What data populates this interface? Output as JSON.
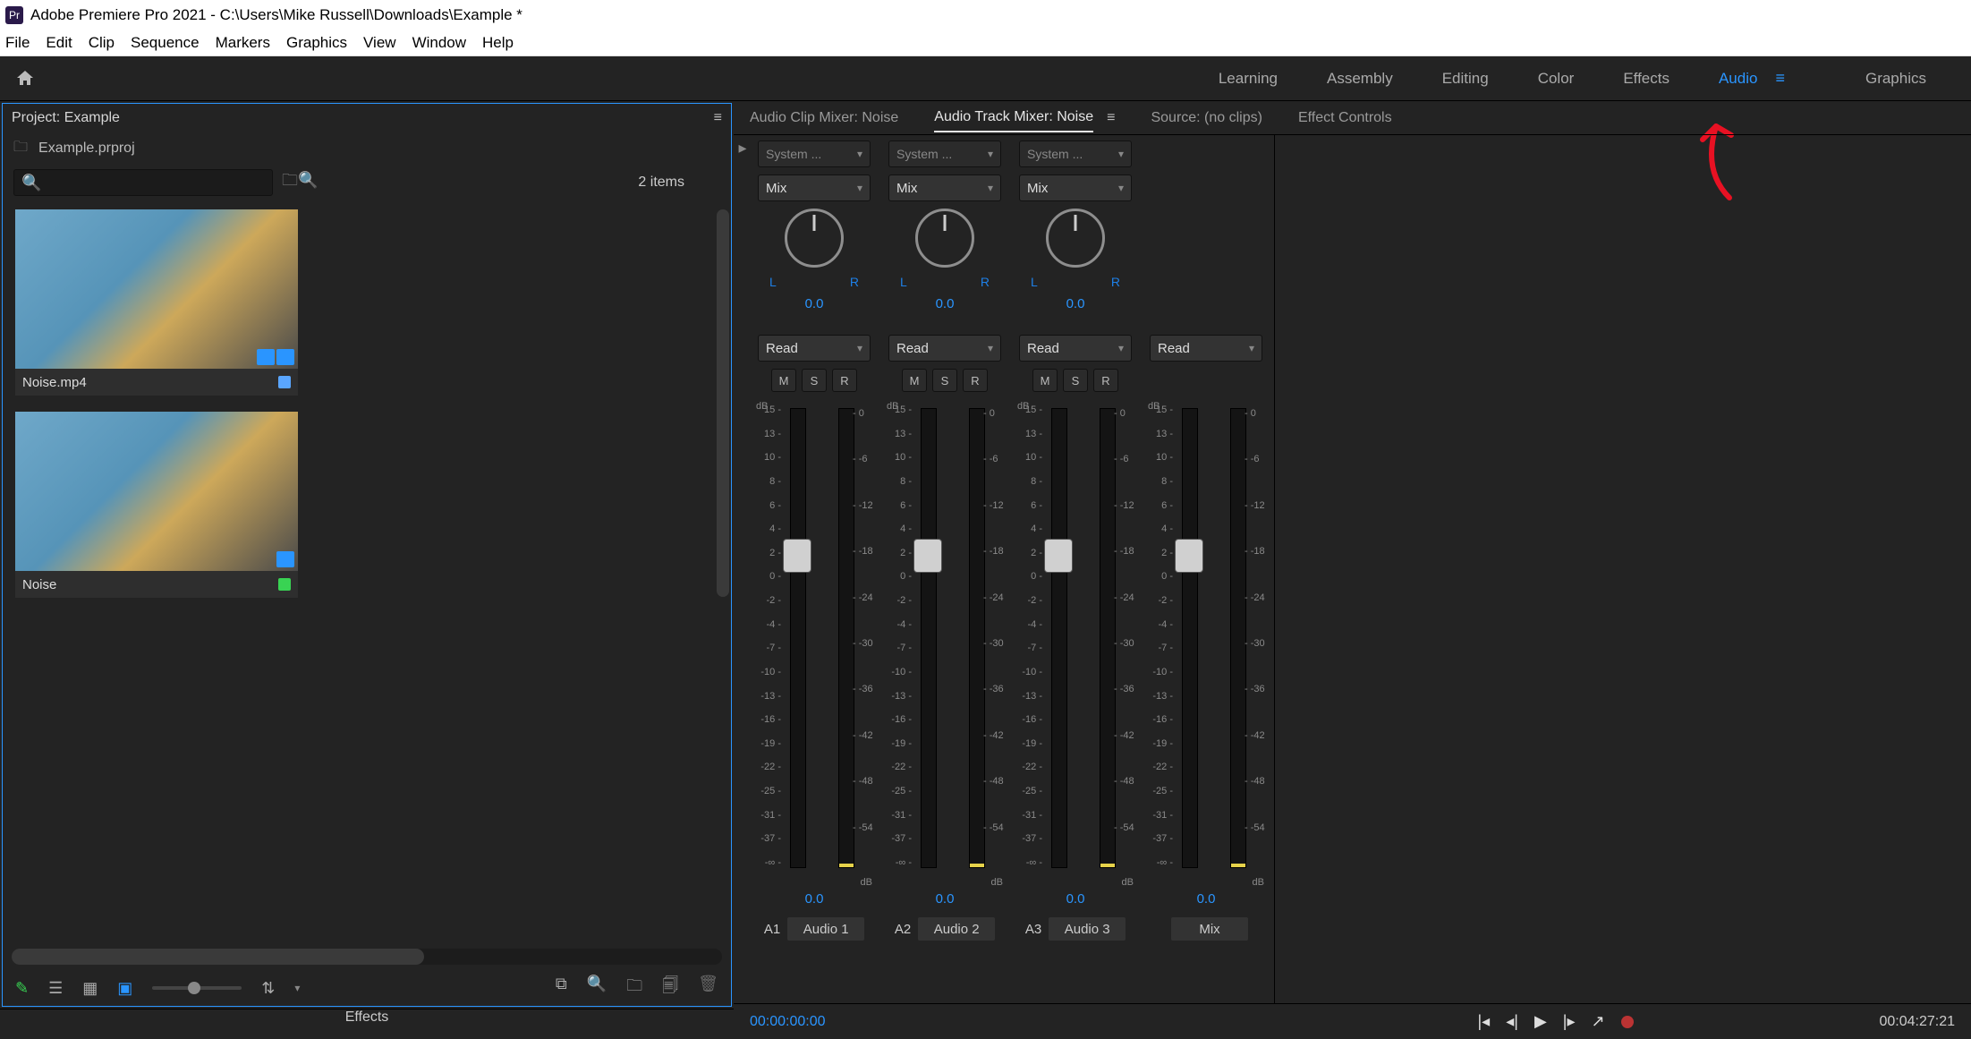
{
  "window": {
    "title": "Adobe Premiere Pro 2021 - C:\\Users\\Mike Russell\\Downloads\\Example *"
  },
  "menu": [
    "File",
    "Edit",
    "Clip",
    "Sequence",
    "Markers",
    "Graphics",
    "View",
    "Window",
    "Help"
  ],
  "workspaces": {
    "items": [
      "Learning",
      "Assembly",
      "Editing",
      "Color",
      "Effects",
      "Audio",
      "Graphics"
    ],
    "active": "Audio"
  },
  "project_panel": {
    "title": "Project: Example",
    "project_file": "Example.prproj",
    "search_placeholder": "",
    "item_count_label": "2 items",
    "items": [
      {
        "name": "Noise.mp4",
        "chip_color": "#5aa6ff",
        "badges": 2
      },
      {
        "name": "Noise",
        "chip_color": "#39d353",
        "badges": 1
      }
    ]
  },
  "effects_panel": {
    "title": "Effects"
  },
  "source_tabs": {
    "items": [
      "Audio Clip Mixer: Noise",
      "Audio Track Mixer: Noise",
      "Source: (no clips)",
      "Effect Controls"
    ],
    "active_index": 1
  },
  "mixer": {
    "system_label": "System ...",
    "mix_label": "Mix",
    "auto_label": "Read",
    "msr": [
      "M",
      "S",
      "R"
    ],
    "pan_value": "0.0",
    "lr": {
      "l": "L",
      "r": "R"
    },
    "db_label_top": "dB",
    "db_label_bottom": "dB",
    "fader_scale": [
      "15 -",
      "13 -",
      "10 -",
      "8 -",
      "6 -",
      "4 -",
      "2 -",
      "0 -",
      "-2 -",
      "-4 -",
      "-7 -",
      "-10 -",
      "-13 -",
      "-16 -",
      "-19 -",
      "-22 -",
      "-25 -",
      "-31 -",
      "-37 -",
      "-∞ -"
    ],
    "meter_scale": [
      "- 0",
      "- -6",
      "- -12",
      "- -18",
      "- -24",
      "- -30",
      "- -36",
      "- -42",
      "- -48",
      "- -54",
      ""
    ],
    "volume_value": "0.0",
    "tracks": [
      {
        "assign_id": "A1",
        "name": "Audio 1"
      },
      {
        "assign_id": "A2",
        "name": "Audio 2"
      },
      {
        "assign_id": "A3",
        "name": "Audio 3"
      }
    ],
    "master": {
      "name": "Mix"
    }
  },
  "transport": {
    "timecode_in": "00:00:00:00",
    "timecode_out": "00:04:27:21"
  }
}
